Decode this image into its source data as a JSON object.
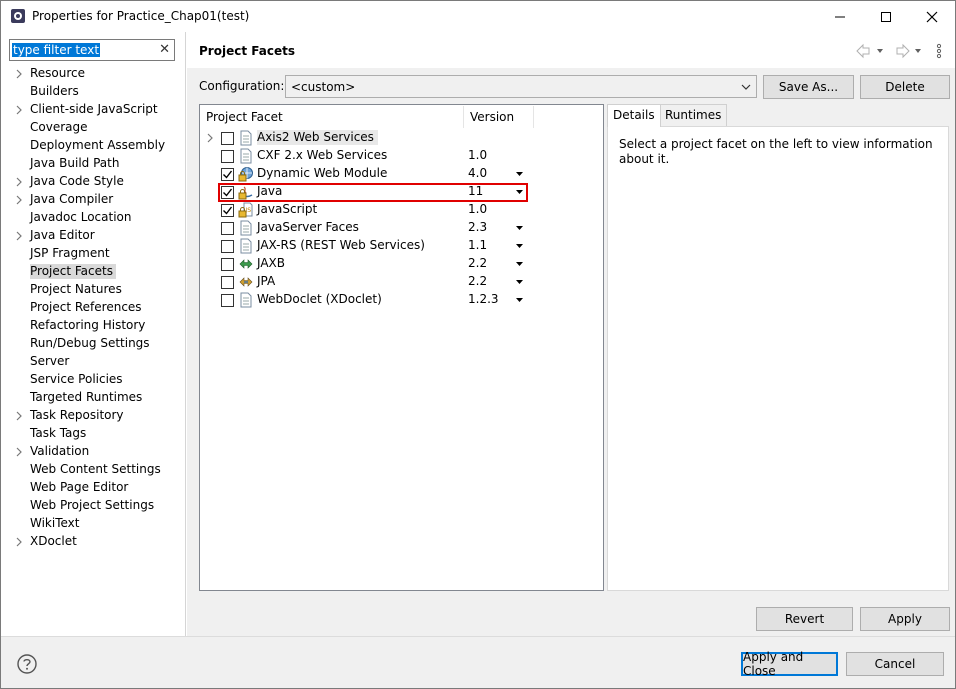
{
  "window": {
    "title": "Properties for Practice_Chap01(test)",
    "minimize_icon": "minimize-icon",
    "maximize_icon": "maximize-icon",
    "close_icon": "close-icon"
  },
  "filter": {
    "text": "type filter text",
    "clear_icon": "clear-icon"
  },
  "tree": [
    {
      "label": "Resource",
      "expandable": true
    },
    {
      "label": "Builders",
      "expandable": false
    },
    {
      "label": "Client-side JavaScript",
      "expandable": true
    },
    {
      "label": "Coverage",
      "expandable": false
    },
    {
      "label": "Deployment Assembly",
      "expandable": false
    },
    {
      "label": "Java Build Path",
      "expandable": false
    },
    {
      "label": "Java Code Style",
      "expandable": true
    },
    {
      "label": "Java Compiler",
      "expandable": true
    },
    {
      "label": "Javadoc Location",
      "expandable": false
    },
    {
      "label": "Java Editor",
      "expandable": true
    },
    {
      "label": "JSP Fragment",
      "expandable": false
    },
    {
      "label": "Project Facets",
      "expandable": false,
      "selected": true
    },
    {
      "label": "Project Natures",
      "expandable": false
    },
    {
      "label": "Project References",
      "expandable": false
    },
    {
      "label": "Refactoring History",
      "expandable": false
    },
    {
      "label": "Run/Debug Settings",
      "expandable": false
    },
    {
      "label": "Server",
      "expandable": false
    },
    {
      "label": "Service Policies",
      "expandable": false
    },
    {
      "label": "Targeted Runtimes",
      "expandable": false
    },
    {
      "label": "Task Repository",
      "expandable": true
    },
    {
      "label": "Task Tags",
      "expandable": false
    },
    {
      "label": "Validation",
      "expandable": true
    },
    {
      "label": "Web Content Settings",
      "expandable": false
    },
    {
      "label": "Web Page Editor",
      "expandable": false
    },
    {
      "label": "Web Project Settings",
      "expandable": false
    },
    {
      "label": "WikiText",
      "expandable": false
    },
    {
      "label": "XDoclet",
      "expandable": true
    }
  ],
  "page": {
    "title": "Project Facets",
    "nav_icons": [
      "back-arrow-icon",
      "forward-arrow-icon",
      "view-menu-icon"
    ]
  },
  "configuration": {
    "label": "Configuration:",
    "value": "<custom>",
    "save_as_label": "Save As...",
    "delete_label": "Delete"
  },
  "facets": {
    "col_facet": "Project Facet",
    "col_version": "Version",
    "rows": [
      {
        "name": "Axis2 Web Services",
        "version": "",
        "checked": false,
        "expandable": true,
        "has_dropdown": false,
        "icon": "document-icon",
        "highlight": true
      },
      {
        "name": "CXF 2.x Web Services",
        "version": "1.0",
        "checked": false,
        "expandable": false,
        "has_dropdown": false,
        "icon": "document-icon"
      },
      {
        "name": "Dynamic Web Module",
        "version": "4.0",
        "checked": true,
        "expandable": false,
        "has_dropdown": true,
        "icon": "web-module-locked-icon"
      },
      {
        "name": "Java",
        "version": "11",
        "checked": true,
        "expandable": false,
        "has_dropdown": true,
        "icon": "java-locked-icon",
        "outlined": true
      },
      {
        "name": "JavaScript",
        "version": "1.0",
        "checked": true,
        "expandable": false,
        "has_dropdown": false,
        "icon": "javascript-locked-icon"
      },
      {
        "name": "JavaServer Faces",
        "version": "2.3",
        "checked": false,
        "expandable": false,
        "has_dropdown": true,
        "icon": "document-icon"
      },
      {
        "name": "JAX-RS (REST Web Services)",
        "version": "1.1",
        "checked": false,
        "expandable": false,
        "has_dropdown": true,
        "icon": "document-icon"
      },
      {
        "name": "JAXB",
        "version": "2.2",
        "checked": false,
        "expandable": false,
        "has_dropdown": true,
        "icon": "jaxb-icon"
      },
      {
        "name": "JPA",
        "version": "2.2",
        "checked": false,
        "expandable": false,
        "has_dropdown": true,
        "icon": "jpa-icon"
      },
      {
        "name": "WebDoclet (XDoclet)",
        "version": "1.2.3",
        "checked": false,
        "expandable": false,
        "has_dropdown": true,
        "icon": "document-icon"
      }
    ]
  },
  "details": {
    "tabs": [
      "Details",
      "Runtimes"
    ],
    "active_tab": "Details",
    "text": "Select a project facet on the left to view information about it."
  },
  "buttons": {
    "revert": "Revert",
    "apply": "Apply",
    "apply_close": "Apply and Close",
    "cancel": "Cancel"
  },
  "help_icon": "help-icon",
  "colors": {
    "selection_blue": "#0078d7",
    "highlight_red": "#e00000",
    "dialog_gray": "#f0f0f0"
  }
}
